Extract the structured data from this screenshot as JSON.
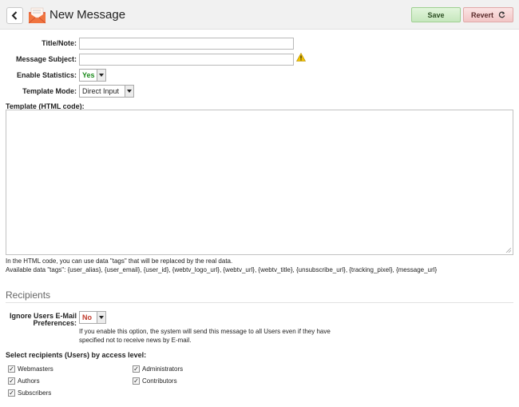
{
  "header": {
    "title": "New Message",
    "back_icon": "chevron-left-icon",
    "app_icon": "envelope-icon",
    "save_label": "Save",
    "revert_label": "Revert",
    "revert_icon": "refresh-icon"
  },
  "form": {
    "title_note_label": "Title/Note:",
    "title_note_value": "",
    "subject_label": "Message Subject:",
    "subject_value": "",
    "subject_warning_icon": "warning-icon",
    "stats_label": "Enable Statistics:",
    "stats_value": "Yes",
    "template_mode_label": "Template Mode:",
    "template_mode_value": "Direct Input",
    "template_label": "Template (HTML code):",
    "template_value": "",
    "template_note_1": "In the HTML code, you can use data \"tags\" that will be replaced by the real data.",
    "template_note_2": "Available data \"tags\": {user_alias}, {user_email}, {user_id}, {webtv_logo_url}, {webtv_url}, {webtv_title}, {unsubscribe_url}, {tracking_pixel}, {message_url}"
  },
  "recipients": {
    "section_title": "Recipients",
    "ignore_label_1": "Ignore Users E-Mail",
    "ignore_label_2": "Preferences:",
    "ignore_value": "No",
    "ignore_help_1": "If you enable this option, the system will send this message to all Users even if they have",
    "ignore_help_2": "specified not to receive news by E-mail.",
    "select_label": "Select recipients (Users) by access level:",
    "levels": [
      {
        "label": "Webmasters",
        "checked": true
      },
      {
        "label": "Administrators",
        "checked": true
      },
      {
        "label": "Authors",
        "checked": true
      },
      {
        "label": "Contributors",
        "checked": true
      },
      {
        "label": "Subscribers",
        "checked": true
      }
    ]
  },
  "colors": {
    "yes_green": "#1a8a1a",
    "no_red": "#c0392b",
    "save_bg": "#d4eecb",
    "revert_bg": "#f5d5d5"
  }
}
